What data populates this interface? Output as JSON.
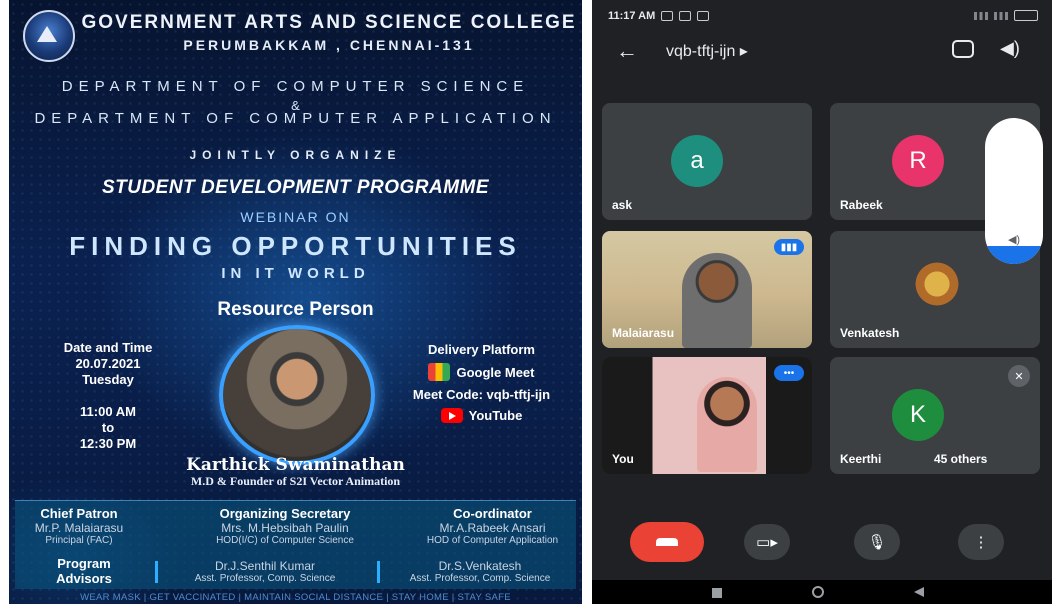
{
  "poster": {
    "college_name": "GOVERNMENT ARTS AND SCIENCE COLLEGE",
    "college_city": "PERUMBAKKAM , CHENNAI-131",
    "department_1": "DEPARTMENT OF COMPUTER SCIENCE",
    "ampersand": "&",
    "department_2": "DEPARTMENT OF COMPUTER APPLICATION",
    "jointly": "JOINTLY ORGANIZE",
    "programme": "STUDENT DEVELOPMENT PROGRAMME",
    "webinar_on": "WEBINAR ON",
    "topic_line1": "FINDING OPPORTUNITIES",
    "topic_line2": "IN IT WORLD",
    "resource_person_title": "Resource Person",
    "date_time_label": "Date and Time",
    "date": "20.07.2021",
    "day": "Tuesday",
    "time_start": "11:00 AM",
    "time_to": "to",
    "time_end": "12:30 PM",
    "delivery_label": "Delivery Platform",
    "platform_meet": "Google Meet",
    "meet_code": "Meet Code: vqb-tftj-ijn",
    "platform_youtube": "YouTube",
    "speaker_name": "Karthick Swaminathan",
    "speaker_designation": "M.D & Founder of S2I Vector Animation",
    "chief_patron_title": "Chief Patron",
    "chief_patron_name": "Mr.P. Malaiarasu",
    "chief_patron_role": "Principal (FAC)",
    "org_secretary_title": "Organizing Secretary",
    "org_secretary_name": "Mrs. M.Hebsibah Paulin",
    "org_secretary_role": "HOD(I/C) of Computer Science",
    "coordinator_title": "Co-ordinator",
    "coordinator_name": "Mr.A.Rabeek Ansari",
    "coordinator_role": "HOD of Computer Application",
    "advisors_title_1": "Program",
    "advisors_title_2": "Advisors",
    "advisor1_name": "Dr.J.Senthil Kumar",
    "advisor1_role": "Asst. Professor, Comp. Science",
    "advisor2_name": "Dr.S.Venkatesh",
    "advisor2_role": "Asst. Professor, Comp. Science",
    "footer": "WEAR MASK | GET VACCINATED | MAINTAIN SOCIAL DISTANCE | STAY HOME | STAY SAFE"
  },
  "meet": {
    "status_time": "11:17 AM",
    "meeting_code": "vqb-tftj-ijn ▸",
    "participants": [
      {
        "initial": "a",
        "name": "ask",
        "color": "#1e8e7e"
      },
      {
        "initial": "R",
        "name": "Rabeek",
        "color": "#e8336b"
      },
      {
        "initial": "",
        "name": "Malaiarasu"
      },
      {
        "initial": "",
        "name": "Venkatesh"
      },
      {
        "initial": "",
        "name": "You"
      },
      {
        "initial": "K",
        "name": "Keerthi",
        "color": "#1e8e3e"
      }
    ],
    "others_count": "45 others",
    "volume_level": 0.12,
    "accent": "#1a73e8",
    "end_call_color": "#ea4335"
  }
}
